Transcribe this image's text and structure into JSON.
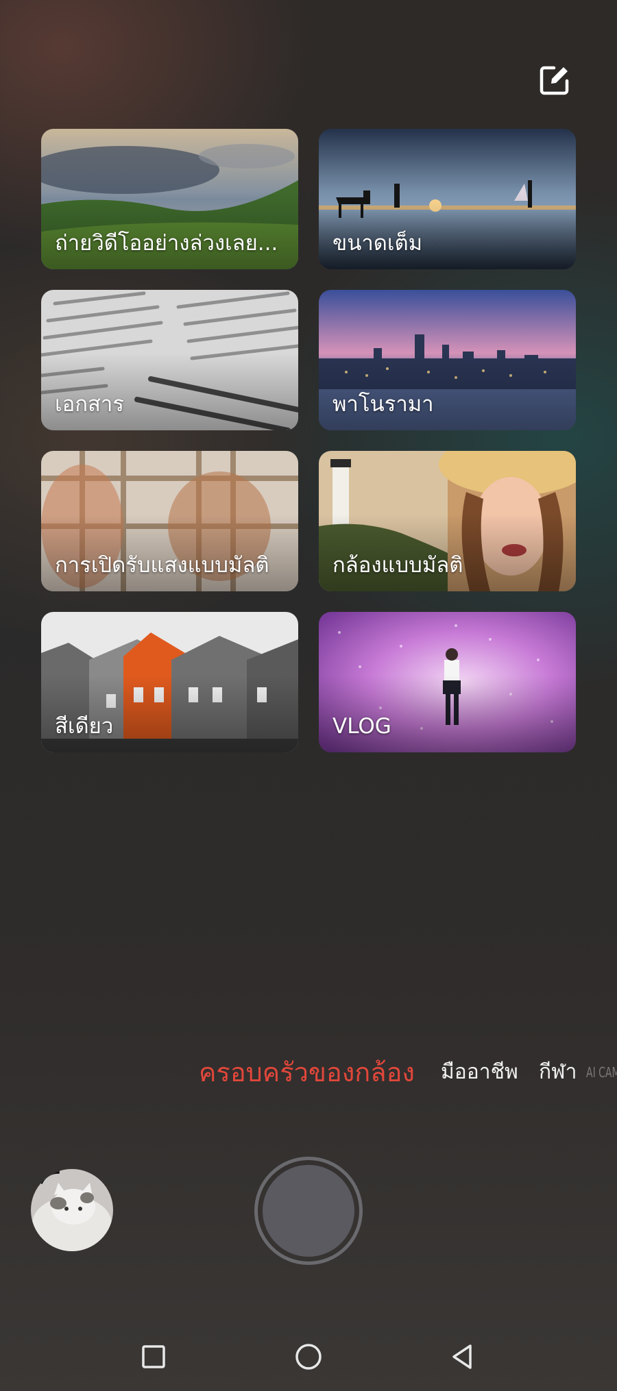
{
  "header": {
    "edit_icon": "edit-icon"
  },
  "modes": [
    {
      "label": "ถ่ายวิดีโออย่างล่วงเลย...",
      "thumb": "green-hills-sky"
    },
    {
      "label": "ขนาดเต็ม",
      "thumb": "sunset-reflection-horse"
    },
    {
      "label": "เอกสาร",
      "thumb": "printed-text-page"
    },
    {
      "label": "พาโนรามา",
      "thumb": "city-skyline-dusk"
    },
    {
      "label": "การเปิดรับแสงแบบมัลติ",
      "thumb": "double-exposure-window"
    },
    {
      "label": "กล้องแบบมัลติ",
      "thumb": "lighthouse-and-selfie"
    },
    {
      "label": "สีเดียว",
      "thumb": "orange-house-mono"
    },
    {
      "label": "VLOG",
      "thumb": "purple-light-tunnel"
    }
  ],
  "mode_tabs": {
    "active": "ครอบครัวของกล้อง",
    "pro": "มืออาชีพ",
    "sport": "กีฬา",
    "ai": "AI CAM"
  },
  "controls": {
    "gallery_icon": "gallery-thumbnail",
    "shutter_icon": "shutter-button"
  },
  "nav": {
    "recent_icon": "square-icon",
    "home_icon": "circle-icon",
    "back_icon": "triangle-back-icon"
  },
  "colors": {
    "active_tab": "#e2473b",
    "shutter": "#5a5a60"
  }
}
